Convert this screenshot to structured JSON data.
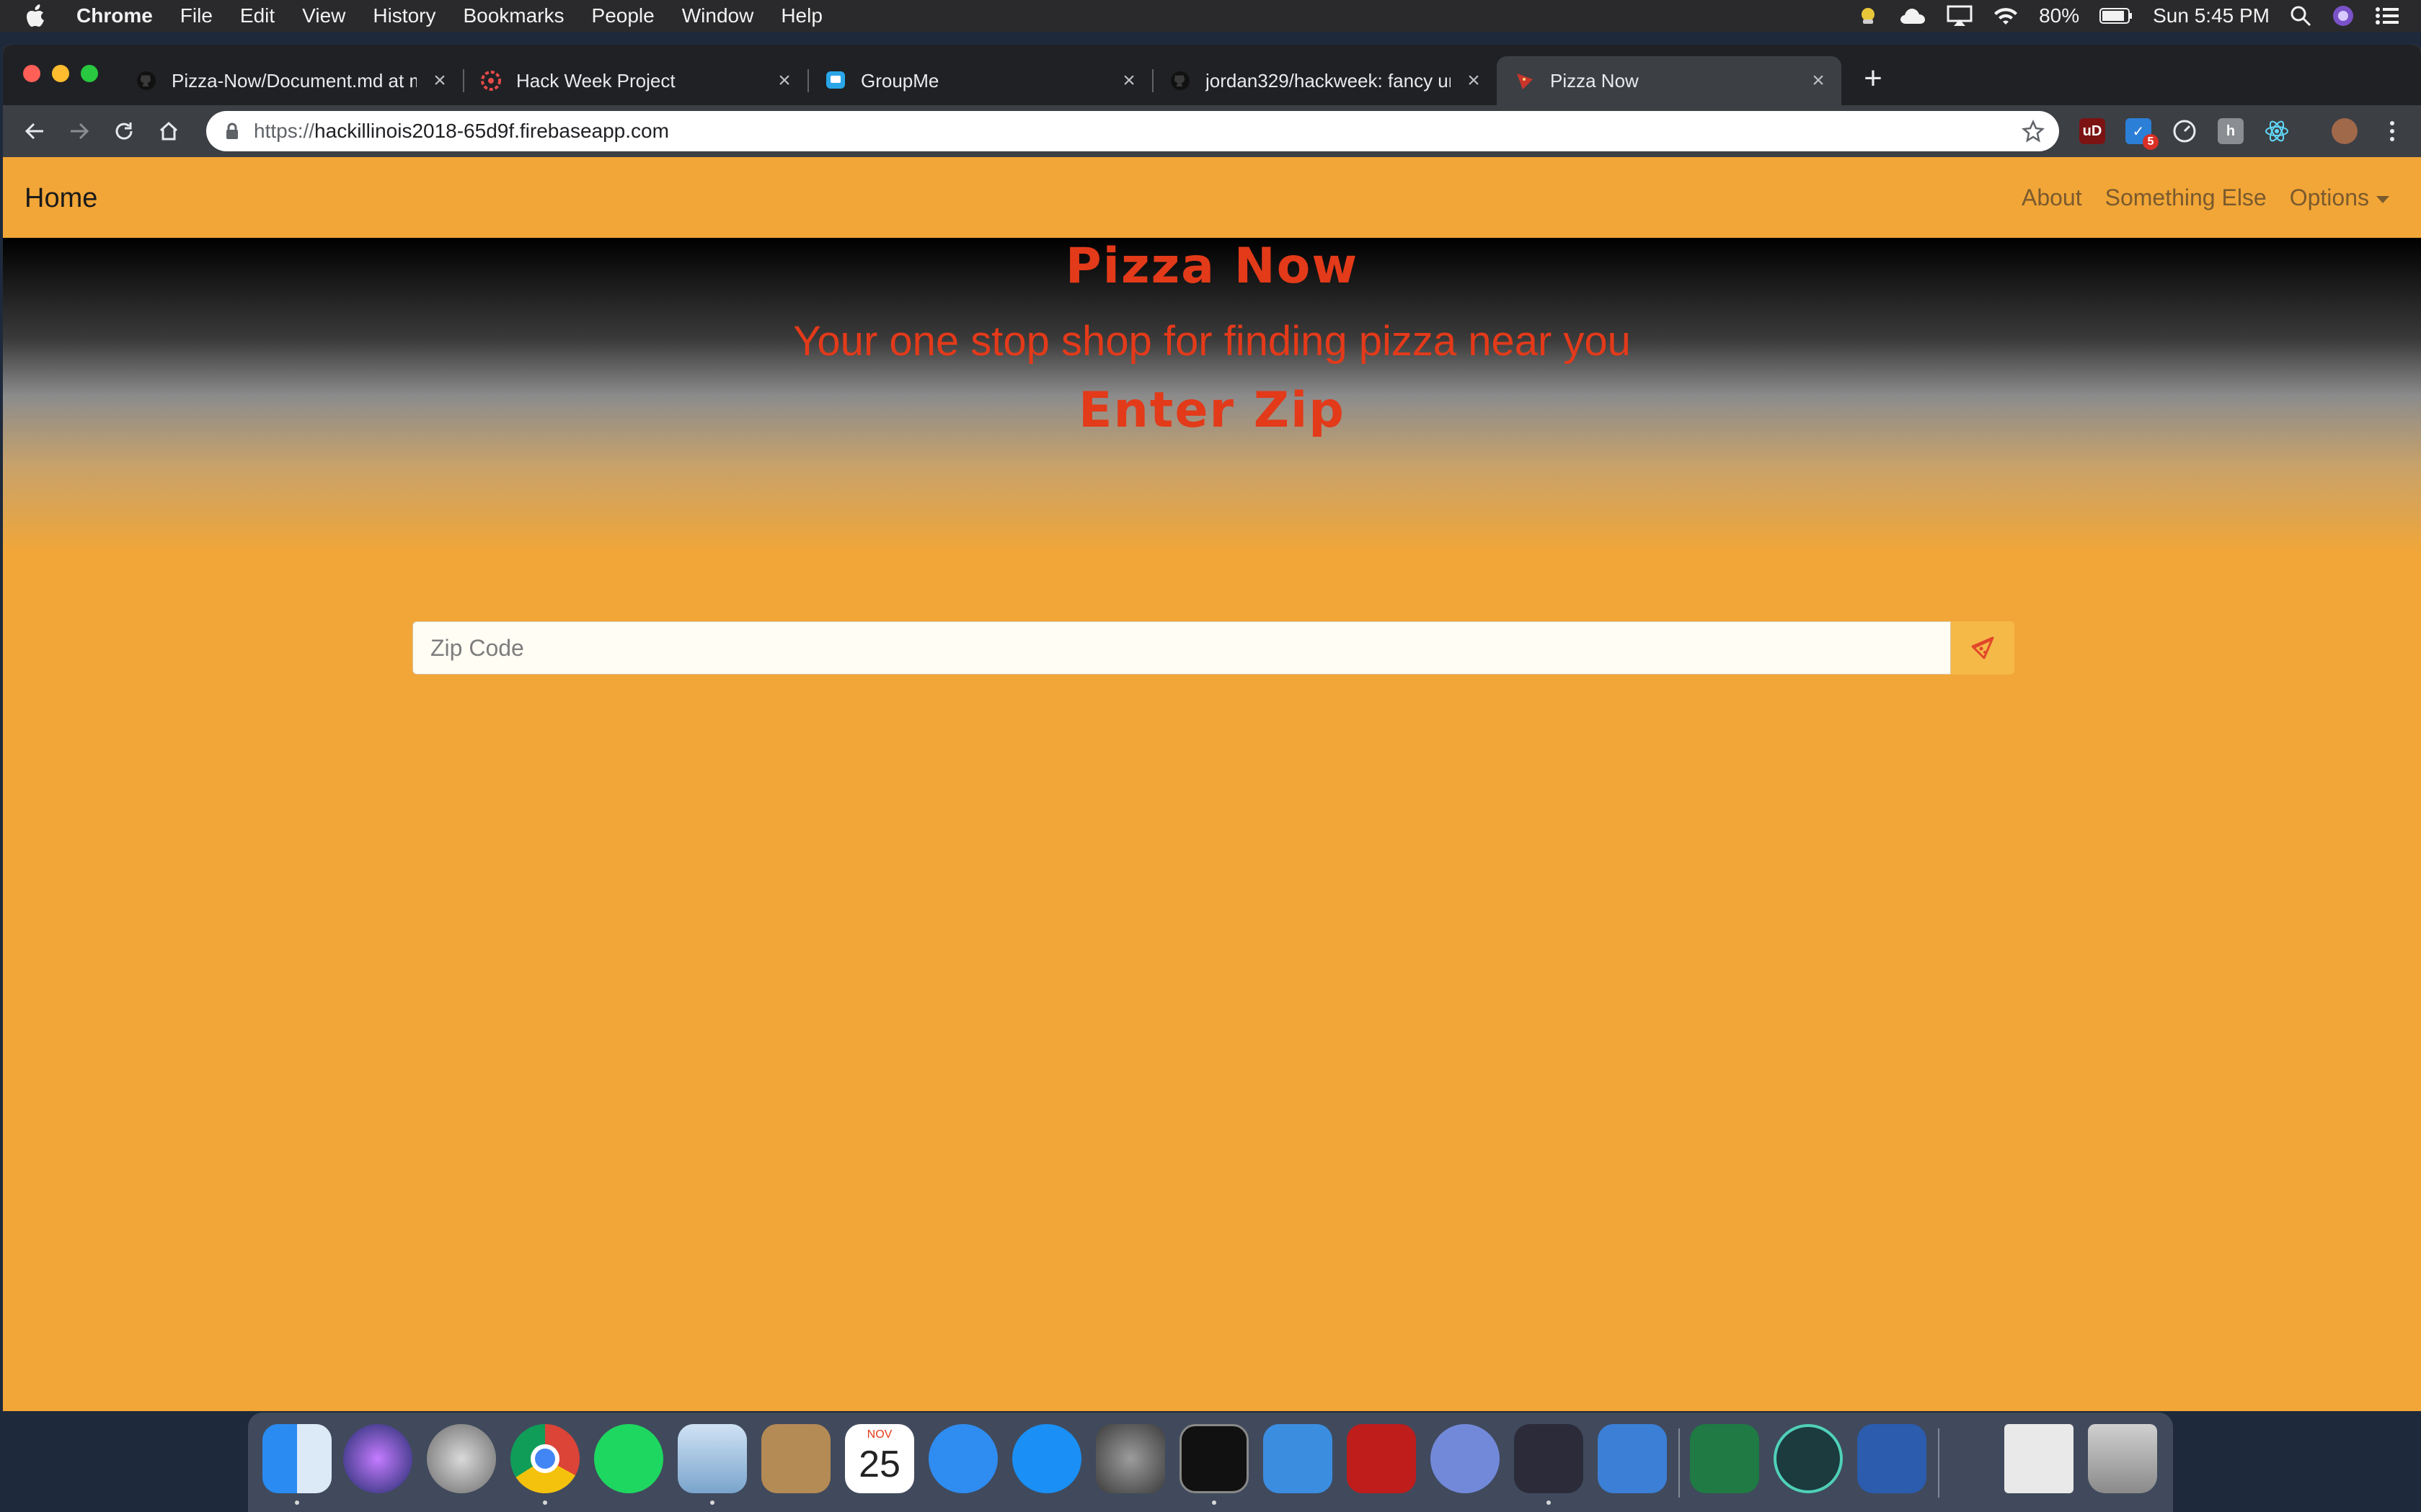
{
  "menubar": {
    "app_name": "Chrome",
    "items": [
      "File",
      "Edit",
      "View",
      "History",
      "Bookmarks",
      "People",
      "Window",
      "Help"
    ],
    "battery": "80%",
    "clock": "Sun 5:45 PM"
  },
  "browser": {
    "tabs": [
      {
        "title": "Pizza-Now/Document.md at m",
        "icon": "github-icon"
      },
      {
        "title": "Hack Week Project",
        "icon": "hackillinois-icon"
      },
      {
        "title": "GroupMe",
        "icon": "groupme-icon"
      },
      {
        "title": "jordan329/hackweek: fancy un",
        "icon": "github-icon"
      },
      {
        "title": "Pizza Now",
        "icon": "pizza-icon",
        "active": true
      }
    ],
    "address": {
      "scheme": "https://",
      "host": "hackillinois2018-65d9f.firebaseapp.com"
    },
    "extension_badge": "5"
  },
  "navbar": {
    "brand": "Home",
    "links": [
      "About",
      "Something Else",
      "Options"
    ]
  },
  "hero": {
    "title": "Pizza Now",
    "subtitle": "Your one stop shop for finding pizza near you",
    "prompt": "Enter Zip"
  },
  "search": {
    "placeholder": "Zip Code",
    "value": "",
    "button_icon": "pizza-slice-icon"
  },
  "dock": {
    "calendar_month": "NOV",
    "calendar_day": "25",
    "apps": [
      "finder",
      "siri",
      "launchpad",
      "chrome",
      "spotify",
      "mail",
      "contacts",
      "calendar",
      "messages",
      "app-store",
      "system-preferences",
      "terminal",
      "xcode",
      "filezilla",
      "discord",
      "vscode",
      "simulator",
      "excel",
      "gitkraken",
      "word",
      "preview",
      "trash"
    ]
  },
  "colors": {
    "page_background": "#f2a637",
    "heading_red": "#e33a1a",
    "chrome_dark": "#202124"
  }
}
